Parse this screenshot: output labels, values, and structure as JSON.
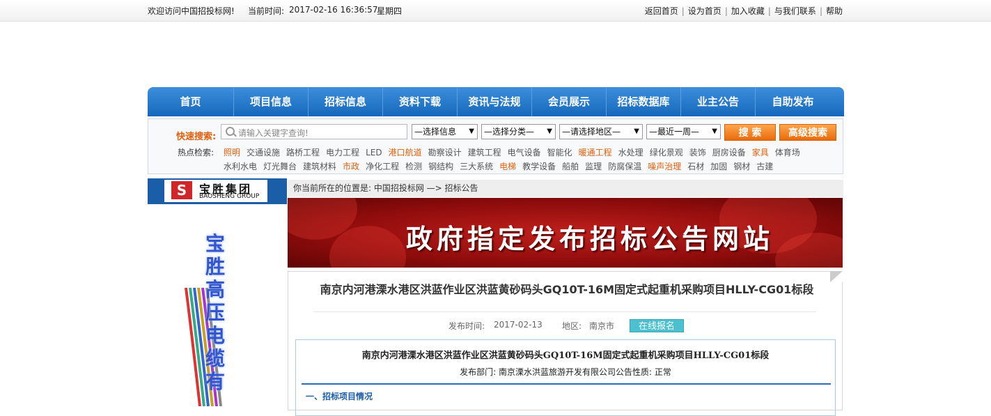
{
  "topbar": {
    "welcome": "欢迎访问中国招投标网!",
    "time_label": "当前时间:",
    "time_value": "2017-02-16 16:36:57",
    "weekday": "星期四",
    "links": [
      "返回首页",
      "设为首页",
      "加入收藏",
      "与我们联系",
      "帮助"
    ]
  },
  "nav": {
    "items": [
      "首页",
      "项目信息",
      "招标信息",
      "资料下载",
      "资讯与法规",
      "会员展示",
      "招标数据库",
      "业主公告",
      "自助发布"
    ]
  },
  "search": {
    "label": "快速搜索:",
    "placeholder": "请输入关键字查询!",
    "selects": [
      "—选择信息",
      "—选择分类—",
      "—请选择地区—",
      "—最近一周—"
    ],
    "search_button": "搜 索",
    "advanced_button": "高级搜索",
    "hot_label": "热点检索:",
    "hot_row1": [
      {
        "text": "照明",
        "hl": true
      },
      {
        "text": "交通设施",
        "hl": false
      },
      {
        "text": "路桥工程",
        "hl": false
      },
      {
        "text": "电力工程",
        "hl": false
      },
      {
        "text": "LED",
        "hl": false
      },
      {
        "text": "港口航道",
        "hl": true
      },
      {
        "text": "勘察设计",
        "hl": false
      },
      {
        "text": "建筑工程",
        "hl": false
      },
      {
        "text": "电气设备",
        "hl": false
      },
      {
        "text": "智能化",
        "hl": false
      },
      {
        "text": "暖通工程",
        "hl": true
      },
      {
        "text": "水处理",
        "hl": false
      },
      {
        "text": "绿化景观",
        "hl": false
      },
      {
        "text": "装饰",
        "hl": false
      },
      {
        "text": "厨房设备",
        "hl": false
      },
      {
        "text": "家具",
        "hl": true
      },
      {
        "text": "体育场",
        "hl": false
      }
    ],
    "hot_row2": [
      {
        "text": "水利水电",
        "hl": false
      },
      {
        "text": "灯光舞台",
        "hl": false
      },
      {
        "text": "建筑材料",
        "hl": false
      },
      {
        "text": "市政",
        "hl": true
      },
      {
        "text": "净化工程",
        "hl": false
      },
      {
        "text": "检测",
        "hl": false
      },
      {
        "text": "钢结构",
        "hl": false
      },
      {
        "text": "三大系统",
        "hl": false
      },
      {
        "text": "电梯",
        "hl": true
      },
      {
        "text": "教学设备",
        "hl": false
      },
      {
        "text": "船舶",
        "hl": false
      },
      {
        "text": "监理",
        "hl": false
      },
      {
        "text": "防腐保温",
        "hl": false
      },
      {
        "text": "噪声治理",
        "hl": true
      },
      {
        "text": "石材",
        "hl": false
      },
      {
        "text": "加固",
        "hl": false
      },
      {
        "text": "钢材",
        "hl": false
      },
      {
        "text": "古建",
        "hl": false
      }
    ]
  },
  "ad": {
    "logo_cn": "宝胜集团",
    "logo_en": "BAOSHENG GROUP",
    "logo_mark": "S",
    "vertical_text": "宝胜高压电缆有"
  },
  "breadcrumb": "你当前所在的位置是: 中国招投标网 —> 招标公告",
  "banner": {
    "title": "政府指定发布招标公告网站"
  },
  "article": {
    "title": "南京内河港溧水港区洪蓝作业区洪蓝黄砂码头GQ10T-16M固定式起重机采购项目HLLY-CG01标段",
    "date_label": "发布时间:",
    "date_value": "2017-02-13",
    "region_label": "地区:",
    "region_value": "南京市",
    "apply_button": "在线报名",
    "inner_title": "南京内河港溧水港区洪蓝作业区洪蓝黄砂码头GQ10T-16M固定式起重机采购项目HLLY-CG01标段",
    "dept_text": "发布部门: 南京溧水洪蓝旅游开发有限公司公告性质: 正常",
    "section1": "一、招标项目情况"
  },
  "colors": {
    "nav_blue": "#1567bb",
    "orange": "#e0600e",
    "banner_red": "#a8140f",
    "apply_teal": "#4cc0cf"
  }
}
